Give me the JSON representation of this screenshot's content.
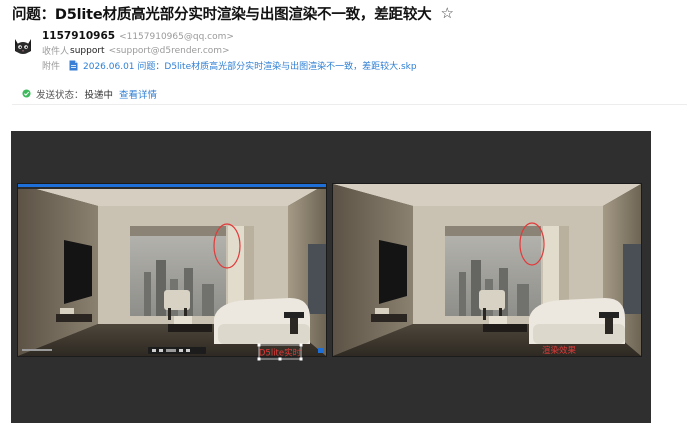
{
  "email": {
    "subject": "问题：D5lite材质高光部分实时渲染与出图渲染不一致，差距较大",
    "star_icon": "star-outline-icon",
    "sender": {
      "name": "1157910965",
      "email": "<1157910965@qq.com>",
      "avatar_icon": "cat-avatar-icon"
    },
    "recipient": {
      "label": "收件人",
      "name": "support",
      "email": "<support@d5render.com>"
    },
    "attachment": {
      "label": "附件",
      "icon": "document-icon",
      "filename": "2026.06.01 问题：D5lite材质高光部分实时渲染与出图渲染不一致，差距较大.skp"
    },
    "delivery": {
      "label": "发送状态：",
      "value": "投递中",
      "details_link": "查看详情",
      "icon": "status-dot-icon",
      "icon_color": "#3dbb5c"
    }
  },
  "screenshot": {
    "left_caption": "D5lite实时",
    "right_caption": "渲染效果",
    "annotation_color": "#e23a3a",
    "frame_color": "#2f2f2f",
    "toolbar_accent": "#1f6fd9"
  }
}
